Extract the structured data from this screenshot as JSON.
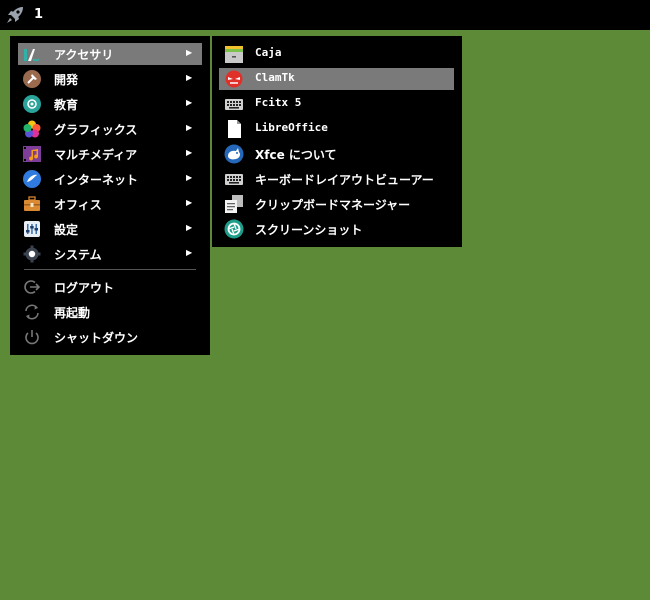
{
  "panel": {
    "workspace_label": "1",
    "launcher_icon": "rocket-icon"
  },
  "menu": {
    "categories": [
      {
        "label": "アクセサリ",
        "icon": "accessories-icon"
      },
      {
        "label": "開発",
        "icon": "development-icon"
      },
      {
        "label": "教育",
        "icon": "education-icon"
      },
      {
        "label": "グラフィックス",
        "icon": "graphics-icon"
      },
      {
        "label": "マルチメディア",
        "icon": "multimedia-icon"
      },
      {
        "label": "インターネット",
        "icon": "internet-icon"
      },
      {
        "label": "オフィス",
        "icon": "office-icon"
      },
      {
        "label": "設定",
        "icon": "settings-icon"
      },
      {
        "label": "システム",
        "icon": "system-icon"
      }
    ],
    "actions": [
      {
        "label": "ログアウト",
        "icon": "logout-icon"
      },
      {
        "label": "再起動",
        "icon": "restart-icon"
      },
      {
        "label": "シャットダウン",
        "icon": "power-icon"
      }
    ],
    "submenu_arrow": "▶",
    "highlighted_category": "アクセサリ"
  },
  "submenu": {
    "items": [
      {
        "label": "Caja",
        "icon": "file-cabinet-icon"
      },
      {
        "label": "ClamTk",
        "icon": "clamtk-icon"
      },
      {
        "label": "Fcitx 5",
        "icon": "keyboard-icon"
      },
      {
        "label": "LibreOffice",
        "icon": "document-icon"
      },
      {
        "label": "Xfce について",
        "icon": "xfce-mouse-icon"
      },
      {
        "label": "キーボードレイアウトビューアー",
        "icon": "keyboard-icon"
      },
      {
        "label": "クリップボードマネージャー",
        "icon": "clipboard-icon"
      },
      {
        "label": "スクリーンショット",
        "icon": "screenshot-icon"
      }
    ],
    "highlighted_item": "ClamTk"
  },
  "colors": {
    "desktop": "#5d8a36",
    "menu_bg": "#000000",
    "highlight": "#7a7a7a",
    "text": "#ffffff"
  }
}
